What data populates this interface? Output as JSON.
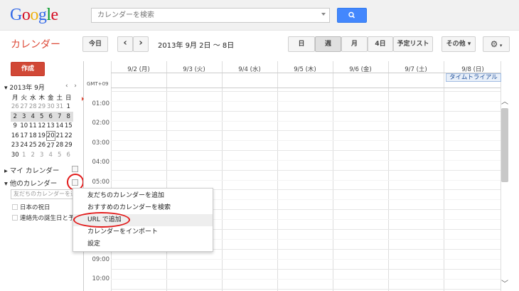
{
  "header": {
    "logo_letters": [
      "G",
      "o",
      "o",
      "g",
      "l",
      "e"
    ],
    "search_placeholder": "カレンダーを検索"
  },
  "toolbar": {
    "app_title": "カレンダー",
    "today": "今日",
    "prev": "‹",
    "next": "›",
    "date_range": "2013年 9月 2日 ～ 8日",
    "views": [
      "日",
      "週",
      "月",
      "4日",
      "予定リスト"
    ],
    "selected_view": "週",
    "more": "その他 ▾",
    "settings_icon": "gear-icon"
  },
  "sidebar": {
    "create": "作成",
    "mini_calendar": {
      "title": "2013年 9月",
      "weekdays": [
        "月",
        "火",
        "水",
        "木",
        "金",
        "土",
        "日"
      ],
      "weeks": [
        [
          "26",
          "27",
          "28",
          "29",
          "30",
          "31",
          "1"
        ],
        [
          "2",
          "3",
          "4",
          "5",
          "6",
          "7",
          "8"
        ],
        [
          "9",
          "10",
          "11",
          "12",
          "13",
          "14",
          "15"
        ],
        [
          "16",
          "17",
          "18",
          "19",
          "20",
          "21",
          "22"
        ],
        [
          "23",
          "24",
          "25",
          "26",
          "27",
          "28",
          "29"
        ],
        [
          "30",
          "1",
          "2",
          "3",
          "4",
          "5",
          "6"
        ]
      ],
      "today": "20"
    },
    "my_calendars": "マイ カレンダー",
    "other_calendars": "他のカレンダー",
    "add_friend_placeholder": "友だちのカレンダーを追",
    "other_items": [
      "日本の祝日",
      "連絡先の誕生日と予定"
    ]
  },
  "calendar": {
    "gmt": "GMT+09",
    "days": [
      "9/2 (月)",
      "9/3 (火)",
      "9/4 (水)",
      "9/5 (木)",
      "9/6 (金)",
      "9/7 (土)",
      "9/8 (日)"
    ],
    "all_day_event": "タイムトライアル",
    "hours": [
      "01:00",
      "02:00",
      "03:00",
      "04:00",
      "05:00",
      "09:00",
      "10:00"
    ]
  },
  "menu": {
    "items": [
      "友だちのカレンダーを追加",
      "おすすめのカレンダーを検索",
      "URL で追加",
      "カレンダーをインポート",
      "設定"
    ],
    "highlighted": "URL で追加"
  },
  "colors": {
    "accent_red": "#d14836",
    "annotation_red": "#e21b1b",
    "search_blue": "#4387fd"
  }
}
